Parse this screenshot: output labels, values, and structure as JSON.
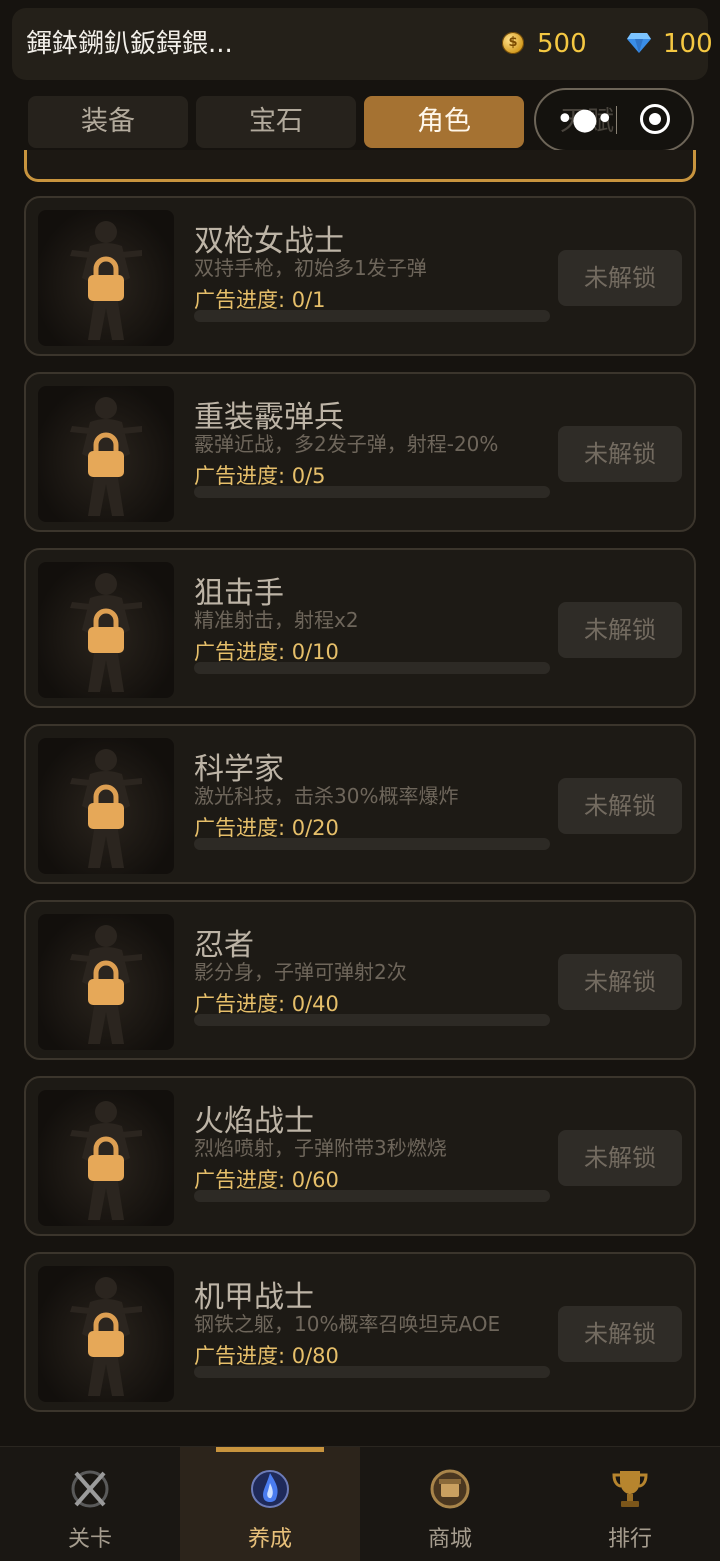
{
  "header": {
    "title": "鍕鉢鎙釟鈑鍀鍡...",
    "coin_icon": "gold-coin-icon",
    "coins": "500",
    "gem_icon": "diamond-icon",
    "gems": "100"
  },
  "tabs": [
    {
      "label": "装备",
      "active": false
    },
    {
      "label": "宝石",
      "active": false
    },
    {
      "label": "角色",
      "active": true
    },
    {
      "label": "天赋",
      "active": false
    }
  ],
  "capsule": {
    "menu_icon": "more-dots-icon",
    "close_icon": "target-close-icon"
  },
  "characters": [
    {
      "name": "双枪女战士",
      "desc": "双持手枪，初始多1发子弹",
      "progress_label": "广告进度: 0/1",
      "progress": 0,
      "button": "未解锁",
      "locked": true
    },
    {
      "name": "重装霰弹兵",
      "desc": "霰弹近战，多2发子弹，射程-20%",
      "progress_label": "广告进度: 0/5",
      "progress": 0,
      "button": "未解锁",
      "locked": true
    },
    {
      "name": "狙击手",
      "desc": "精准射击，射程x2",
      "progress_label": "广告进度: 0/10",
      "progress": 0,
      "button": "未解锁",
      "locked": true
    },
    {
      "name": "科学家",
      "desc": "激光科技，击杀30%概率爆炸",
      "progress_label": "广告进度: 0/20",
      "progress": 0,
      "button": "未解锁",
      "locked": true
    },
    {
      "name": "忍者",
      "desc": "影分身，子弹可弹射2次",
      "progress_label": "广告进度: 0/40",
      "progress": 0,
      "button": "未解锁",
      "locked": true
    },
    {
      "name": "火焰战士",
      "desc": "烈焰喷射，子弹附带3秒燃烧",
      "progress_label": "广告进度: 0/60",
      "progress": 0,
      "button": "未解锁",
      "locked": true
    },
    {
      "name": "机甲战士",
      "desc": "钢铁之躯，10%概率召唤坦克AOE",
      "progress_label": "广告进度: 0/80",
      "progress": 0,
      "button": "未解锁",
      "locked": true
    }
  ],
  "bottom_nav": [
    {
      "label": "关卡",
      "icon": "crossed-swords-icon",
      "active": false
    },
    {
      "label": "养成",
      "icon": "blue-flame-icon",
      "active": true
    },
    {
      "label": "商城",
      "icon": "shop-emblem-icon",
      "active": false
    },
    {
      "label": "排行",
      "icon": "trophy-icon",
      "active": false
    }
  ],
  "colors": {
    "accent": "#a57232",
    "gold_text": "#f5c842",
    "progress_text": "#e6bf6a",
    "lock": "#e6a858"
  }
}
